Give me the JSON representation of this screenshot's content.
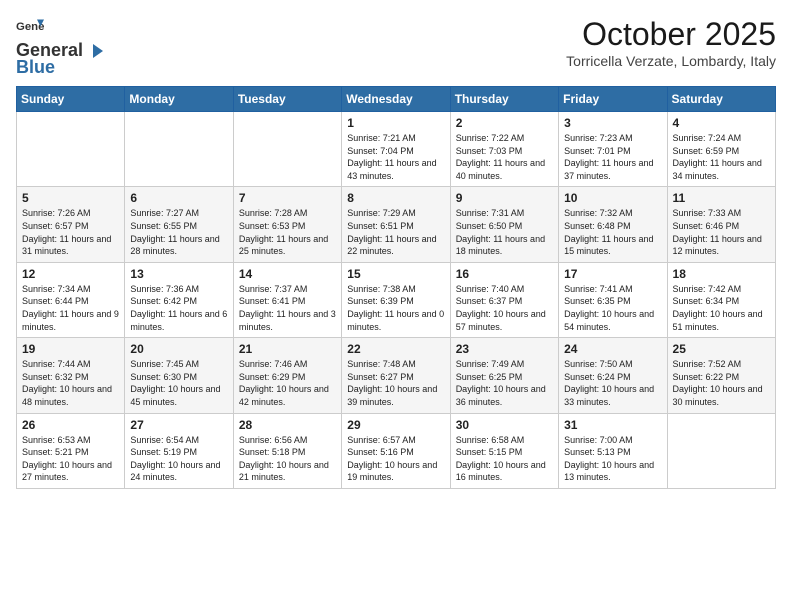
{
  "header": {
    "logo_line1": "General",
    "logo_line2": "Blue",
    "month": "October 2025",
    "location": "Torricella Verzate, Lombardy, Italy"
  },
  "weekdays": [
    "Sunday",
    "Monday",
    "Tuesday",
    "Wednesday",
    "Thursday",
    "Friday",
    "Saturday"
  ],
  "weeks": [
    [
      {
        "day": "",
        "info": ""
      },
      {
        "day": "",
        "info": ""
      },
      {
        "day": "",
        "info": ""
      },
      {
        "day": "1",
        "info": "Sunrise: 7:21 AM\nSunset: 7:04 PM\nDaylight: 11 hours\nand 43 minutes."
      },
      {
        "day": "2",
        "info": "Sunrise: 7:22 AM\nSunset: 7:03 PM\nDaylight: 11 hours\nand 40 minutes."
      },
      {
        "day": "3",
        "info": "Sunrise: 7:23 AM\nSunset: 7:01 PM\nDaylight: 11 hours\nand 37 minutes."
      },
      {
        "day": "4",
        "info": "Sunrise: 7:24 AM\nSunset: 6:59 PM\nDaylight: 11 hours\nand 34 minutes."
      }
    ],
    [
      {
        "day": "5",
        "info": "Sunrise: 7:26 AM\nSunset: 6:57 PM\nDaylight: 11 hours\nand 31 minutes."
      },
      {
        "day": "6",
        "info": "Sunrise: 7:27 AM\nSunset: 6:55 PM\nDaylight: 11 hours\nand 28 minutes."
      },
      {
        "day": "7",
        "info": "Sunrise: 7:28 AM\nSunset: 6:53 PM\nDaylight: 11 hours\nand 25 minutes."
      },
      {
        "day": "8",
        "info": "Sunrise: 7:29 AM\nSunset: 6:51 PM\nDaylight: 11 hours\nand 22 minutes."
      },
      {
        "day": "9",
        "info": "Sunrise: 7:31 AM\nSunset: 6:50 PM\nDaylight: 11 hours\nand 18 minutes."
      },
      {
        "day": "10",
        "info": "Sunrise: 7:32 AM\nSunset: 6:48 PM\nDaylight: 11 hours\nand 15 minutes."
      },
      {
        "day": "11",
        "info": "Sunrise: 7:33 AM\nSunset: 6:46 PM\nDaylight: 11 hours\nand 12 minutes."
      }
    ],
    [
      {
        "day": "12",
        "info": "Sunrise: 7:34 AM\nSunset: 6:44 PM\nDaylight: 11 hours\nand 9 minutes."
      },
      {
        "day": "13",
        "info": "Sunrise: 7:36 AM\nSunset: 6:42 PM\nDaylight: 11 hours\nand 6 minutes."
      },
      {
        "day": "14",
        "info": "Sunrise: 7:37 AM\nSunset: 6:41 PM\nDaylight: 11 hours\nand 3 minutes."
      },
      {
        "day": "15",
        "info": "Sunrise: 7:38 AM\nSunset: 6:39 PM\nDaylight: 11 hours\nand 0 minutes."
      },
      {
        "day": "16",
        "info": "Sunrise: 7:40 AM\nSunset: 6:37 PM\nDaylight: 10 hours\nand 57 minutes."
      },
      {
        "day": "17",
        "info": "Sunrise: 7:41 AM\nSunset: 6:35 PM\nDaylight: 10 hours\nand 54 minutes."
      },
      {
        "day": "18",
        "info": "Sunrise: 7:42 AM\nSunset: 6:34 PM\nDaylight: 10 hours\nand 51 minutes."
      }
    ],
    [
      {
        "day": "19",
        "info": "Sunrise: 7:44 AM\nSunset: 6:32 PM\nDaylight: 10 hours\nand 48 minutes."
      },
      {
        "day": "20",
        "info": "Sunrise: 7:45 AM\nSunset: 6:30 PM\nDaylight: 10 hours\nand 45 minutes."
      },
      {
        "day": "21",
        "info": "Sunrise: 7:46 AM\nSunset: 6:29 PM\nDaylight: 10 hours\nand 42 minutes."
      },
      {
        "day": "22",
        "info": "Sunrise: 7:48 AM\nSunset: 6:27 PM\nDaylight: 10 hours\nand 39 minutes."
      },
      {
        "day": "23",
        "info": "Sunrise: 7:49 AM\nSunset: 6:25 PM\nDaylight: 10 hours\nand 36 minutes."
      },
      {
        "day": "24",
        "info": "Sunrise: 7:50 AM\nSunset: 6:24 PM\nDaylight: 10 hours\nand 33 minutes."
      },
      {
        "day": "25",
        "info": "Sunrise: 7:52 AM\nSunset: 6:22 PM\nDaylight: 10 hours\nand 30 minutes."
      }
    ],
    [
      {
        "day": "26",
        "info": "Sunrise: 6:53 AM\nSunset: 5:21 PM\nDaylight: 10 hours\nand 27 minutes."
      },
      {
        "day": "27",
        "info": "Sunrise: 6:54 AM\nSunset: 5:19 PM\nDaylight: 10 hours\nand 24 minutes."
      },
      {
        "day": "28",
        "info": "Sunrise: 6:56 AM\nSunset: 5:18 PM\nDaylight: 10 hours\nand 21 minutes."
      },
      {
        "day": "29",
        "info": "Sunrise: 6:57 AM\nSunset: 5:16 PM\nDaylight: 10 hours\nand 19 minutes."
      },
      {
        "day": "30",
        "info": "Sunrise: 6:58 AM\nSunset: 5:15 PM\nDaylight: 10 hours\nand 16 minutes."
      },
      {
        "day": "31",
        "info": "Sunrise: 7:00 AM\nSunset: 5:13 PM\nDaylight: 10 hours\nand 13 minutes."
      },
      {
        "day": "",
        "info": ""
      }
    ]
  ]
}
